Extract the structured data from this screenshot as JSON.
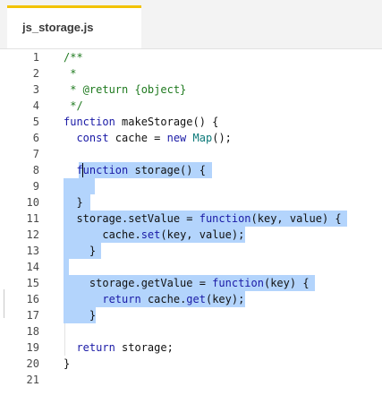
{
  "tab": {
    "filename": "js_storage.js"
  },
  "lines": [
    {
      "num": "1",
      "text": "/**"
    },
    {
      "num": "2",
      "text": " *"
    },
    {
      "num": "3",
      "text": " * @return {object}"
    },
    {
      "num": "4",
      "text": " */"
    },
    {
      "num": "5",
      "text": "function makeStorage() {"
    },
    {
      "num": "6",
      "text": "  const cache = new Map();"
    },
    {
      "num": "7",
      "text": ""
    },
    {
      "num": "8",
      "text": "  function storage() {"
    },
    {
      "num": "9",
      "text": ""
    },
    {
      "num": "10",
      "text": "  }"
    },
    {
      "num": "11",
      "text": "  storage.setValue = function(key, value) {"
    },
    {
      "num": "12",
      "text": "      cache.set(key, value);"
    },
    {
      "num": "13",
      "text": "    }"
    },
    {
      "num": "14",
      "text": ""
    },
    {
      "num": "15",
      "text": "    storage.getValue = function(key) {"
    },
    {
      "num": "16",
      "text": "      return cache.get(key);"
    },
    {
      "num": "17",
      "text": "    }"
    },
    {
      "num": "18",
      "text": ""
    },
    {
      "num": "19",
      "text": "  return storage;"
    },
    {
      "num": "20",
      "text": "}"
    },
    {
      "num": "21",
      "text": ""
    }
  ],
  "colors": {
    "selection": "#b3d4fc",
    "tab_accent": "#f2c200",
    "comment": "#1f7a1f",
    "keyword": "#1a1aa6",
    "type": "#0e7a7a"
  }
}
